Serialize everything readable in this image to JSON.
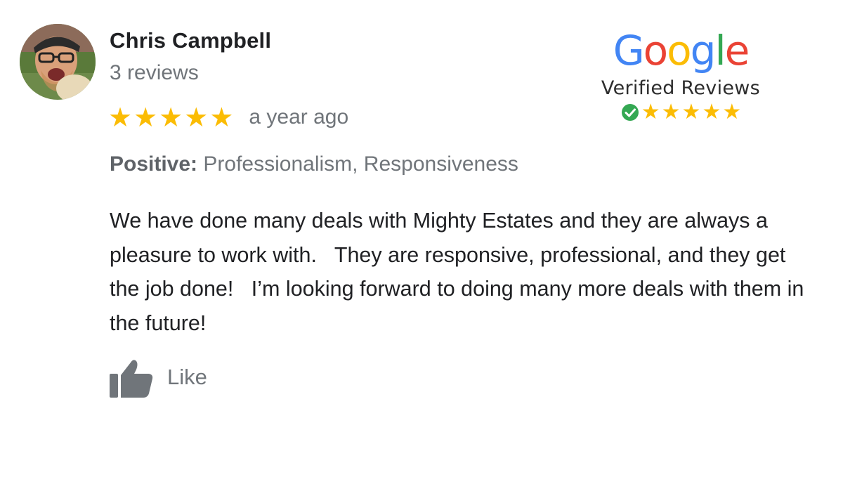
{
  "reviewer": {
    "name": "Chris Campbell",
    "review_count": "3 reviews"
  },
  "rating": {
    "stars": 5,
    "star_glyph": "★",
    "timestamp": "a year ago"
  },
  "positive": {
    "label": "Positive:",
    "value": "Professionalism, Responsiveness"
  },
  "review": {
    "text": "We have done many deals with Mighty Estates and they are always a pleasure to work with.   They are responsive, professional, and they get the job done!   I’m looking forward to doing many more deals with them in the future!"
  },
  "like": {
    "label": "Like",
    "icon": "thumbs-up-icon"
  },
  "badge": {
    "logo_letters": [
      "G",
      "o",
      "o",
      "g",
      "l",
      "e"
    ],
    "verified_label": "Verified Reviews",
    "stars": 5,
    "check_icon": "check-circle-icon"
  },
  "colors": {
    "star": "#fbbc04",
    "google_blue": "#4285f4",
    "google_red": "#ea4335",
    "google_yellow": "#fbbc05",
    "google_green": "#34a853",
    "check_green": "#34a853",
    "muted_text": "#70757a",
    "icon_gray": "#70757a"
  }
}
